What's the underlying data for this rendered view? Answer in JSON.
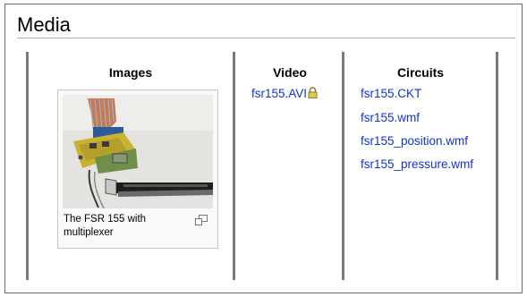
{
  "section": {
    "title": "Media"
  },
  "columns": {
    "images": {
      "title": "Images",
      "thumbnail": {
        "caption": "The FSR 155 with multiplexer",
        "enlarge_icon": "magnify-clip-icon"
      }
    },
    "video": {
      "title": "Video",
      "items": [
        {
          "label": "fsr155.AVI",
          "icon": "lock-icon"
        }
      ]
    },
    "circuits": {
      "title": "Circuits",
      "items": [
        {
          "label": "fsr155.CKT"
        },
        {
          "label": "fsr155.wmf"
        },
        {
          "label": "fsr155_position.wmf"
        },
        {
          "label": "fsr155_pressure.wmf"
        }
      ]
    }
  },
  "colors": {
    "link": "#1133cc",
    "divider": "#7a7a7a",
    "heading_rule": "#aaaaaa"
  }
}
